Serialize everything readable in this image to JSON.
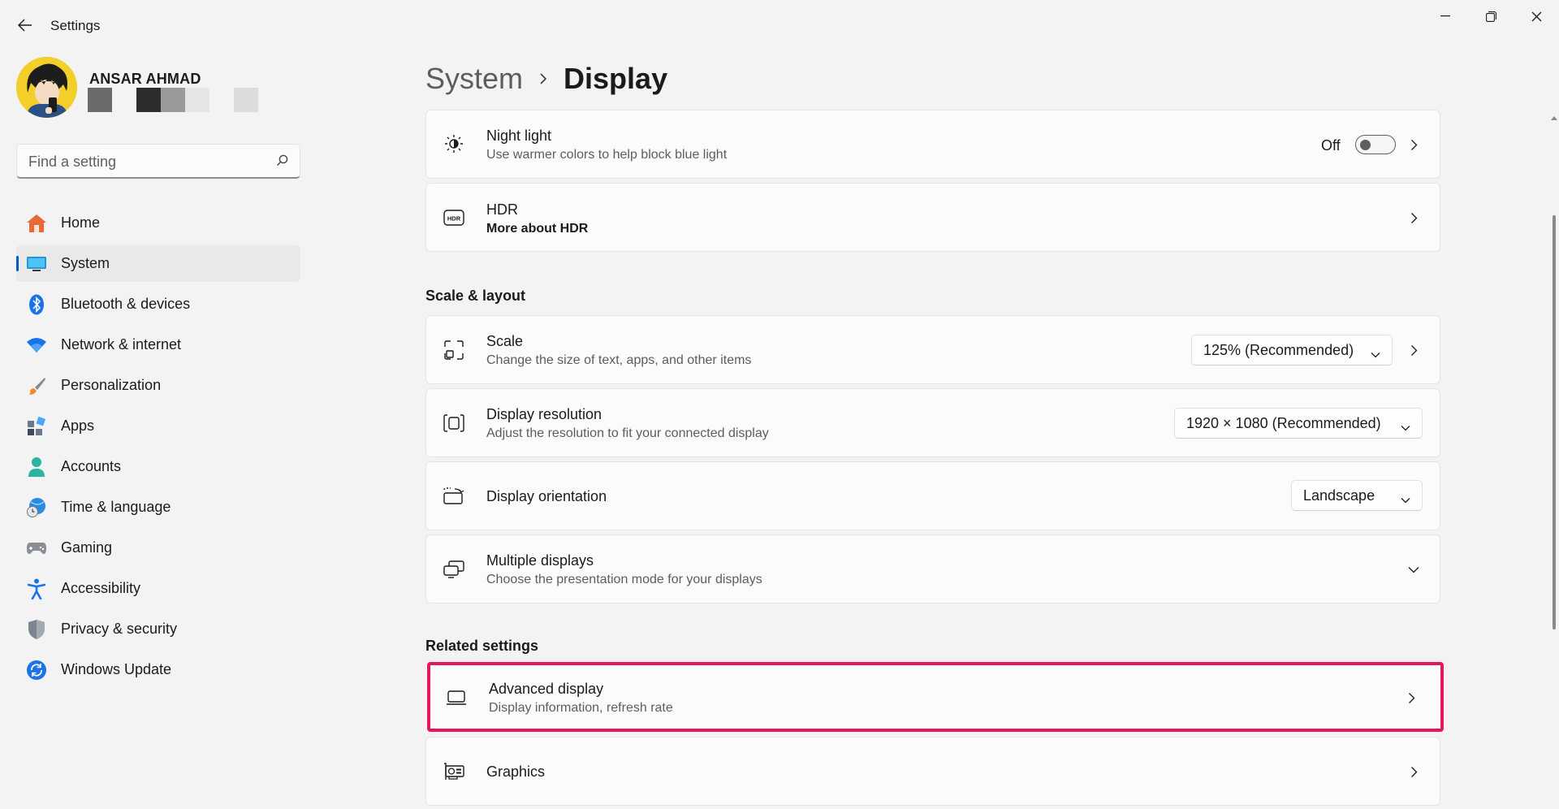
{
  "window": {
    "title": "Settings"
  },
  "profile": {
    "name": "ANSAR AHMAD",
    "swatches": [
      "#6b6b6b",
      "#f3f3f3",
      "#2d2d2d",
      "#9a9a9a",
      "#e6e6e6",
      "#f3f3f3",
      "#dcdcdc"
    ]
  },
  "search": {
    "placeholder": "Find a setting"
  },
  "nav": {
    "items": [
      {
        "label": "Home",
        "icon": "home-icon"
      },
      {
        "label": "System",
        "icon": "system-icon",
        "active": true
      },
      {
        "label": "Bluetooth & devices",
        "icon": "bluetooth-icon"
      },
      {
        "label": "Network & internet",
        "icon": "wifi-icon"
      },
      {
        "label": "Personalization",
        "icon": "brush-icon"
      },
      {
        "label": "Apps",
        "icon": "apps-icon"
      },
      {
        "label": "Accounts",
        "icon": "account-icon"
      },
      {
        "label": "Time & language",
        "icon": "globe-clock-icon"
      },
      {
        "label": "Gaming",
        "icon": "gamepad-icon"
      },
      {
        "label": "Accessibility",
        "icon": "accessibility-icon"
      },
      {
        "label": "Privacy & security",
        "icon": "shield-icon"
      },
      {
        "label": "Windows Update",
        "icon": "update-icon"
      }
    ]
  },
  "breadcrumb": {
    "parent": "System",
    "current": "Display"
  },
  "cards": {
    "night_light": {
      "title": "Night light",
      "subtitle": "Use warmer colors to help block blue light",
      "toggle_label": "Off",
      "toggle_on": false
    },
    "hdr": {
      "title": "HDR",
      "subtitle": "More about HDR"
    },
    "scale": {
      "title": "Scale",
      "subtitle": "Change the size of text, apps, and other items",
      "value": "125% (Recommended)"
    },
    "resolution": {
      "title": "Display resolution",
      "subtitle": "Adjust the resolution to fit your connected display",
      "value": "1920 × 1080 (Recommended)"
    },
    "orientation": {
      "title": "Display orientation",
      "value": "Landscape"
    },
    "multiple": {
      "title": "Multiple displays",
      "subtitle": "Choose the presentation mode for your displays"
    },
    "advanced": {
      "title": "Advanced display",
      "subtitle": "Display information, refresh rate"
    },
    "graphics": {
      "title": "Graphics"
    }
  },
  "sections": {
    "scale_layout": "Scale & layout",
    "related": "Related settings"
  },
  "colors": {
    "accent": "#005fb8",
    "highlight": "#e8175d"
  }
}
